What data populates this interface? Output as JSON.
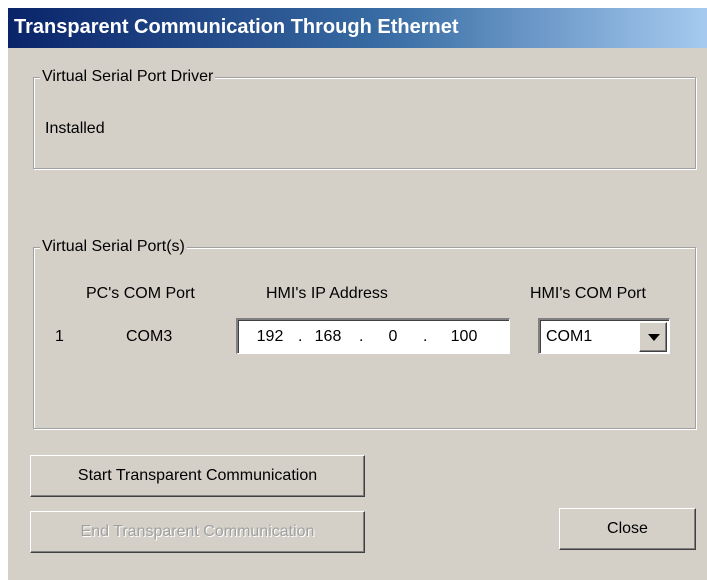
{
  "window": {
    "title": "Transparent Communication Through Ethernet"
  },
  "driver_group": {
    "legend": "Virtual Serial Port Driver",
    "status": "Installed"
  },
  "ports_group": {
    "legend": "Virtual Serial Port(s)",
    "columns": {
      "pc_com_port": "PC's COM Port",
      "hmi_ip_address": "HMI's IP Address",
      "hmi_com_port": "HMI's COM Port"
    },
    "rows": [
      {
        "index": "1",
        "pc_com_port": "COM3",
        "ip_octets": [
          "192",
          "168",
          "0",
          "100"
        ],
        "hmi_com_port": "COM1"
      }
    ]
  },
  "buttons": {
    "start": "Start Transparent Communication",
    "end": "End Transparent Communication",
    "close": "Close"
  },
  "state": {
    "end_button_enabled": false
  },
  "colors": {
    "dialog_bg": "#d4d0c8",
    "title_gradient_start": "#0a246a",
    "title_gradient_end": "#a6caf0",
    "disabled_text": "#a0a0a0"
  }
}
